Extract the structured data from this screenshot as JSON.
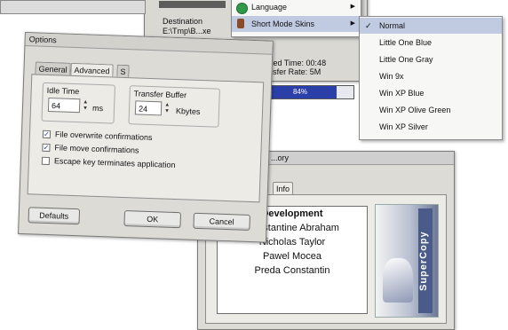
{
  "main_window": {
    "title_fragment": "Language",
    "language_label": "Language",
    "skin_label": "Short Mode Skins",
    "destination_label": "Destination",
    "destination_value": "E:\\Tmp\\B...xe",
    "elapsed_label": "Elapsed Time:",
    "elapsed_value": "00:48",
    "transfer_rate_label": "Transfer Rate:",
    "transfer_rate_value": "5M",
    "progress_text": "84%",
    "progress": 0.84
  },
  "skins_menu": {
    "items": [
      {
        "label": "Normal",
        "checked": true
      },
      {
        "label": "Little One Blue",
        "checked": false
      },
      {
        "label": "Little One Gray",
        "checked": false
      },
      {
        "label": "Win 9x",
        "checked": false
      },
      {
        "label": "Win XP Blue",
        "checked": false
      },
      {
        "label": "Win XP Olive Green",
        "checked": false
      },
      {
        "label": "Win XP Silver",
        "checked": false
      }
    ]
  },
  "options": {
    "title": "Options",
    "tabs": [
      "General",
      "Advanced",
      "S"
    ],
    "idle_time_label": "Idle Time",
    "idle_time_value": "64",
    "idle_time_unit": "ms",
    "transfer_buffer_label": "Transfer Buffer",
    "transfer_buffer_value": "24",
    "transfer_buffer_unit": "Kbytes",
    "checkboxes": [
      {
        "label": "File overwrite confirmations",
        "checked": true
      },
      {
        "label": "File move confirmations",
        "checked": true
      },
      {
        "label": "Escape key terminates application",
        "checked": false
      }
    ],
    "buttons": {
      "defaults": "Defaults",
      "ok": "OK",
      "cancel": "Cancel"
    }
  },
  "about": {
    "title_fragment": "...ory",
    "tab_label": "Info",
    "credits_heading": "Development",
    "credits": [
      "Constantine Abraham",
      "Nicholas Taylor",
      "Pawel Mocea",
      "Preda Constantin"
    ],
    "logo_text": "SuperCopy"
  }
}
